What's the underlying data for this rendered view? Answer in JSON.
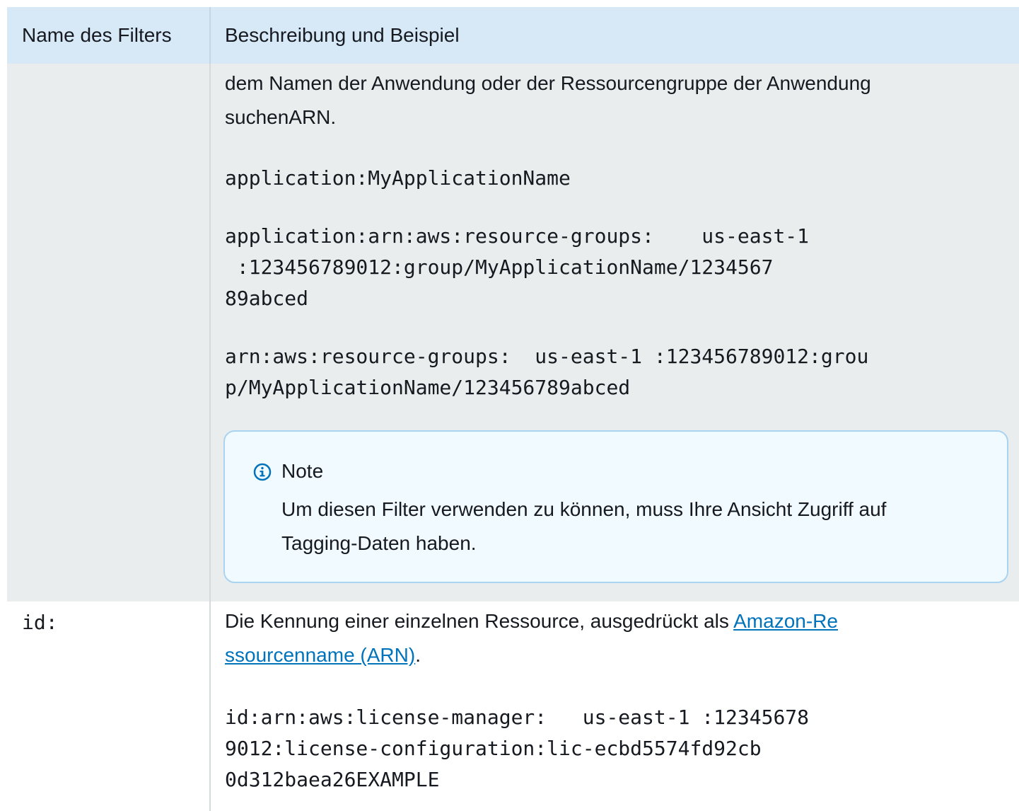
{
  "table": {
    "headers": {
      "col1": "Name des Filters",
      "col2": "Beschreibung und Beispiel"
    },
    "row1": {
      "description_line1": "dem Namen der Anwendung oder der Ressourcengruppe der Anwendung",
      "description_line2": "suchenARN.",
      "example1": "application:MyApplicationName",
      "example2_line1": "application:arn:aws:resource-groups:    us-east-1",
      "example2_line2": " :123456789012:group/MyApplicationName/1234567",
      "example2_line3": "89abced",
      "example3_line1": "arn:aws:resource-groups:  us-east-1 :123456789012:grou",
      "example3_line2": "p/MyApplicationName/123456789abced",
      "note": {
        "icon": "info-icon",
        "title": "Note",
        "body_line1": "Um diesen Filter verwenden zu können, muss Ihre Ansicht Zugriff auf",
        "body_line2": "Tagging-Daten haben."
      }
    },
    "row2": {
      "filter_name": "id:",
      "description_prefix": "Die Kennung einer einzelnen Ressource, ausgedrückt als ",
      "link_part1": "Amazon-Re",
      "link_part2": "ssourcenname (ARN)",
      "description_suffix": ".",
      "example_line1": "id:arn:aws:license-manager:   us-east-1 :12345678",
      "example_line2": "9012:license-configuration:lic-ecbd5574fd92cb",
      "example_line3": "0d312baea26EXAMPLE"
    }
  },
  "colors": {
    "header_bg": "#d7e8f7",
    "row_bg": "#eaeded",
    "note_bg": "#f1faff",
    "note_border": "#a8d4f2",
    "link": "#0073bb",
    "info_icon": "#0073bb"
  }
}
